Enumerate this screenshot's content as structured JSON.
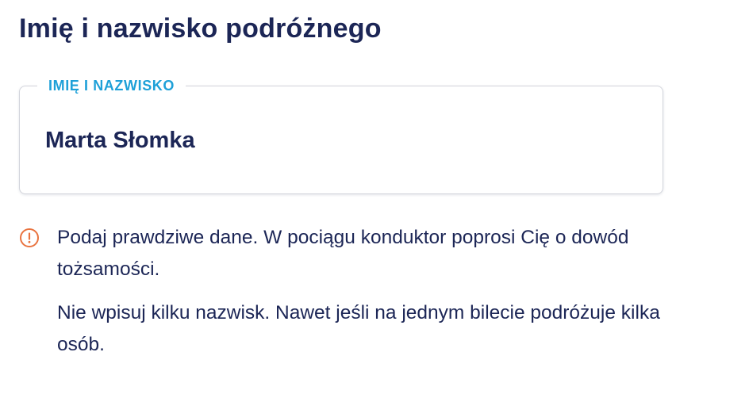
{
  "section": {
    "title": "Imię i nazwisko podróżnego"
  },
  "name_field": {
    "label": "IMIĘ I NAZWISKO",
    "value": "Marta Słomka"
  },
  "notice": {
    "icon": "info-icon",
    "icon_color": "#e9733f",
    "paragraph_1": "Podaj prawdziwe dane. W pociągu konduktor poprosi Cię o dowód tożsamości.",
    "paragraph_2": "Nie wpisuj kilku nazwisk. Nawet jeśli na jednym bilecie podróżuje kilka osób."
  },
  "colors": {
    "text": "#1c2656",
    "label": "#1ea0d8",
    "border": "#d3d5dc"
  }
}
